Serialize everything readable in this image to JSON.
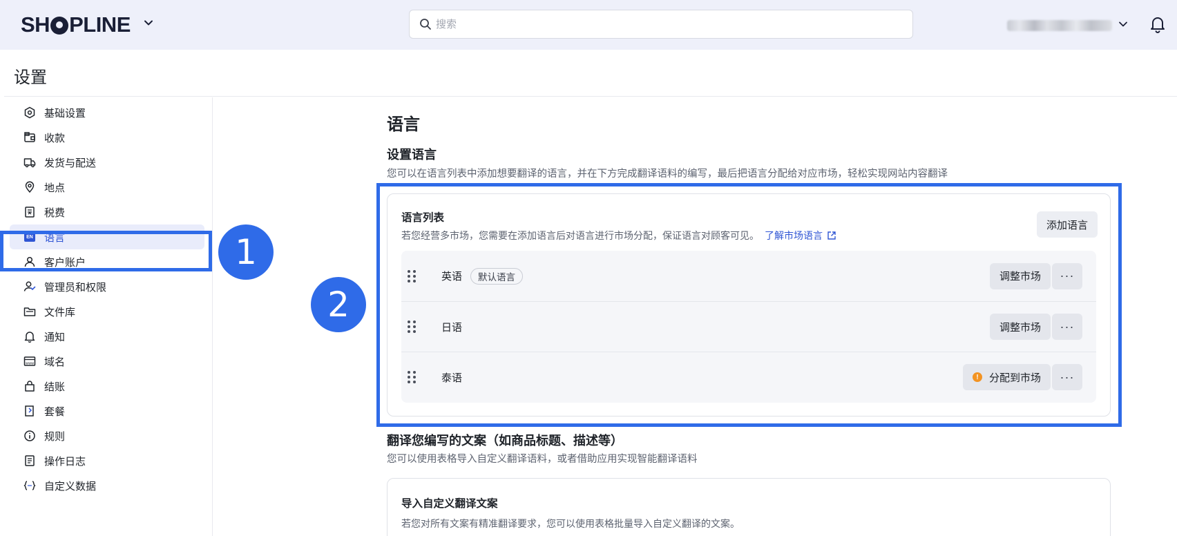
{
  "topbar": {
    "logo_left": "SH",
    "logo_right": "PLINE",
    "search_placeholder": "搜索"
  },
  "page": {
    "title": "设置"
  },
  "sidebar": {
    "items": [
      {
        "label": "基础设置",
        "icon": "gear-hex-icon"
      },
      {
        "label": "收款",
        "icon": "wallet-icon"
      },
      {
        "label": "发货与配送",
        "icon": "truck-icon"
      },
      {
        "label": "地点",
        "icon": "location-pin-icon"
      },
      {
        "label": "税费",
        "icon": "receipt-icon"
      },
      {
        "label": "语言",
        "icon": "language-en-icon",
        "badge": "EN",
        "active": true
      },
      {
        "label": "客户账户",
        "icon": "user-icon"
      },
      {
        "label": "管理员和权限",
        "icon": "user-shield-icon"
      },
      {
        "label": "文件库",
        "icon": "folder-icon"
      },
      {
        "label": "通知",
        "icon": "bell-icon"
      },
      {
        "label": "域名",
        "icon": "domain-icon"
      },
      {
        "label": "结账",
        "icon": "shopping-bag-icon"
      },
      {
        "label": "套餐",
        "icon": "package-icon"
      },
      {
        "label": "规则",
        "icon": "info-circle-icon"
      },
      {
        "label": "操作日志",
        "icon": "log-icon"
      },
      {
        "label": "自定义数据",
        "icon": "code-braces-icon"
      }
    ]
  },
  "annotations": {
    "marker1": "1",
    "marker2": "2",
    "color": "#2f6be8"
  },
  "main": {
    "heading": "语言",
    "set_language": {
      "title": "设置语言",
      "description": "您可以在语言列表中添加想要翻译的语言，并在下方完成翻译语料的编写，最后把语言分配给对应市场，轻松实现网站内容翻译"
    },
    "language_list": {
      "title": "语言列表",
      "description": "若您经营多市场，您需要在添加语言后对语言进行市场分配，保证语言对顾客可见。",
      "link": "了解市场语言",
      "add_button": "添加语言",
      "rows": [
        {
          "name": "英语",
          "badge": "默认语言",
          "action": "调整市场",
          "more": "···"
        },
        {
          "name": "日语",
          "action": "调整市场",
          "more": "···"
        },
        {
          "name": "泰语",
          "action": "分配到市场",
          "warning": "!",
          "more": "···"
        }
      ]
    },
    "translate": {
      "title": "翻译您编写的文案（如商品标题、描述等）",
      "description": "您可以使用表格导入自定义翻译语料，或者借助应用实现智能翻译语料"
    },
    "import_card": {
      "title": "导入自定义翻译文案",
      "description": "若您对所有文案有精准翻译要求，您可以使用表格批量导入自定义翻译的文案。"
    }
  }
}
